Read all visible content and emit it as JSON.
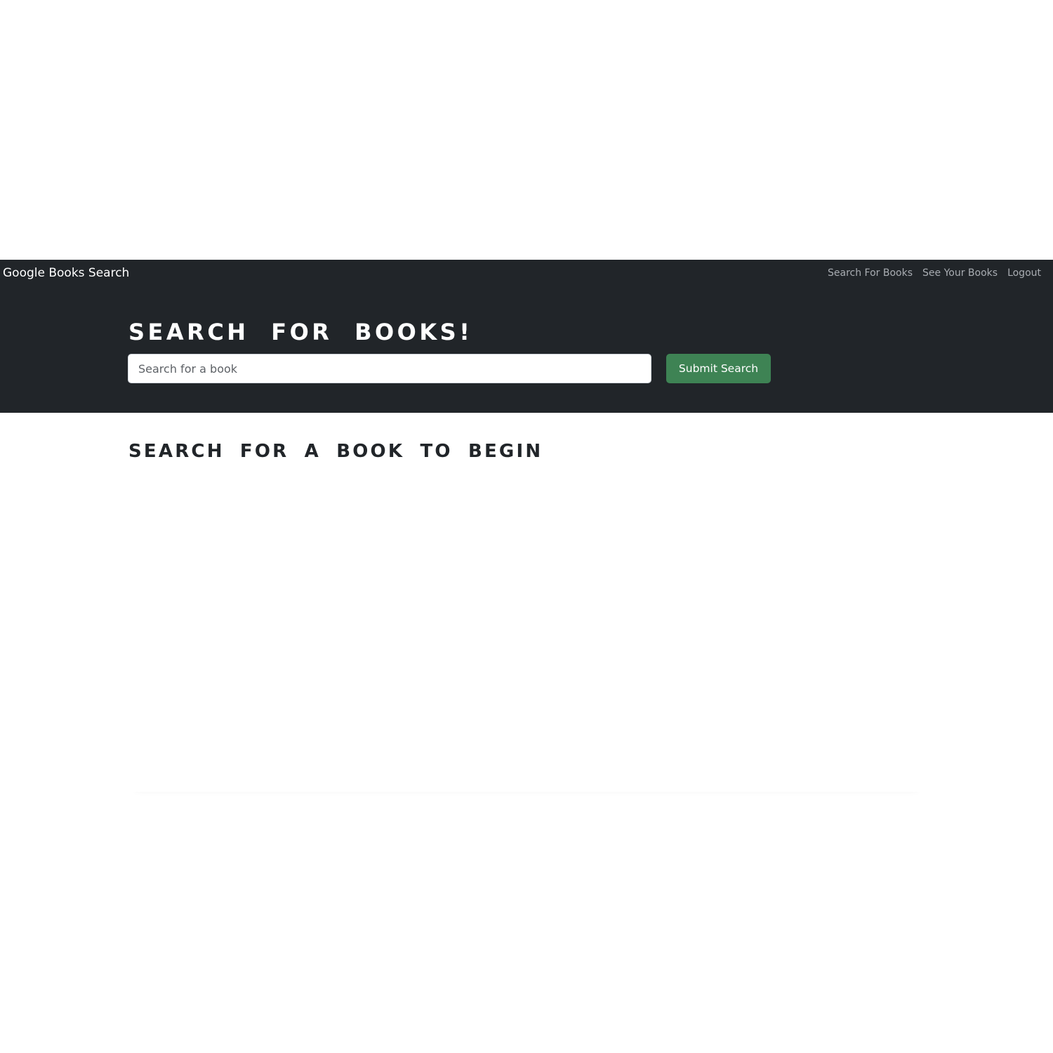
{
  "navbar": {
    "brand": "Google Books Search",
    "links": [
      {
        "label": "Search For Books"
      },
      {
        "label": "See Your Books"
      },
      {
        "label": "Logout"
      }
    ]
  },
  "hero": {
    "title": "Search for Books!",
    "search": {
      "placeholder": "Search for a book",
      "value": ""
    },
    "submit_label": "Submit Search"
  },
  "results": {
    "heading": "Search for a book to begin"
  },
  "colors": {
    "header_bg": "#212529",
    "submit_bg": "#3e8354",
    "heading_text": "#212529",
    "nav_link": "#a9adb2"
  }
}
